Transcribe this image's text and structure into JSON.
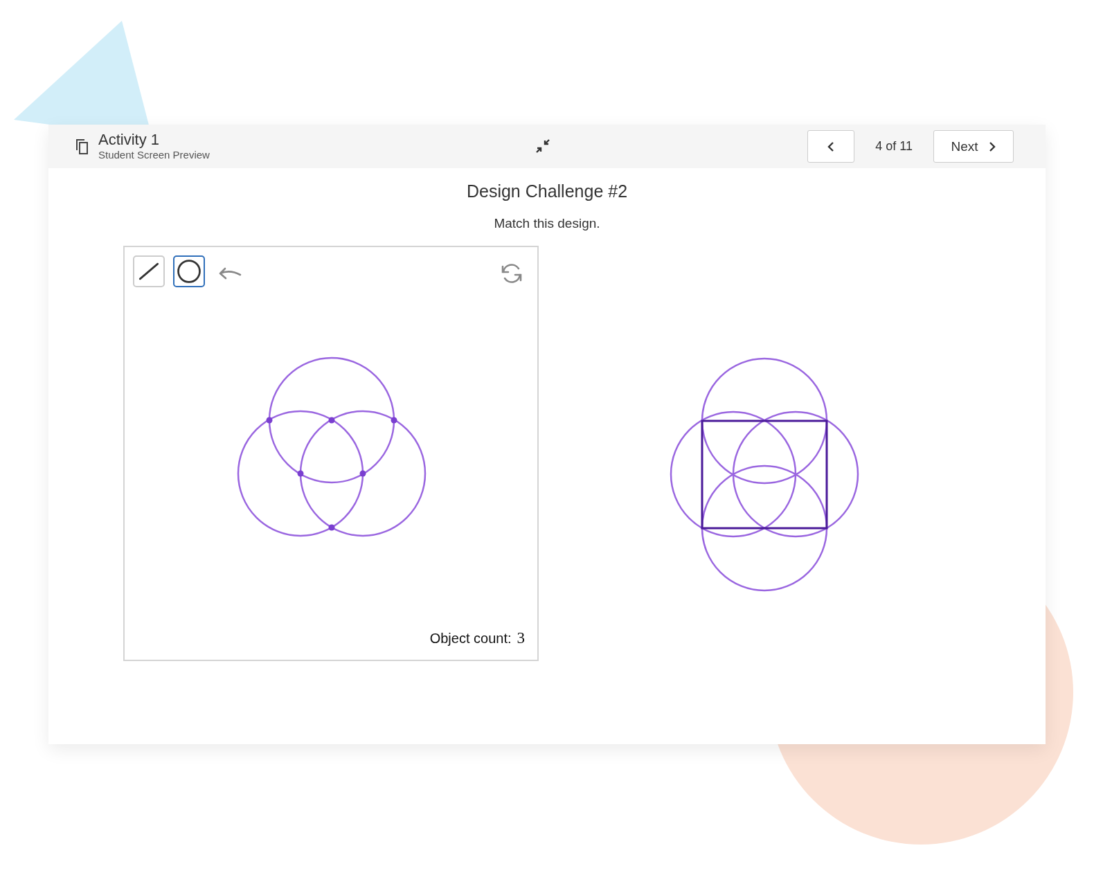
{
  "header": {
    "title": "Activity 1",
    "subtitle": "Student Screen Preview"
  },
  "nav": {
    "position": "4 of 11",
    "next": "Next"
  },
  "heading": "Design Challenge #2",
  "instruction": "Match this design.",
  "tools": [
    {
      "kind": "line",
      "selected": false
    },
    {
      "kind": "circle",
      "selected": true
    }
  ],
  "object_count": {
    "label": "Object count:",
    "value": "3"
  }
}
